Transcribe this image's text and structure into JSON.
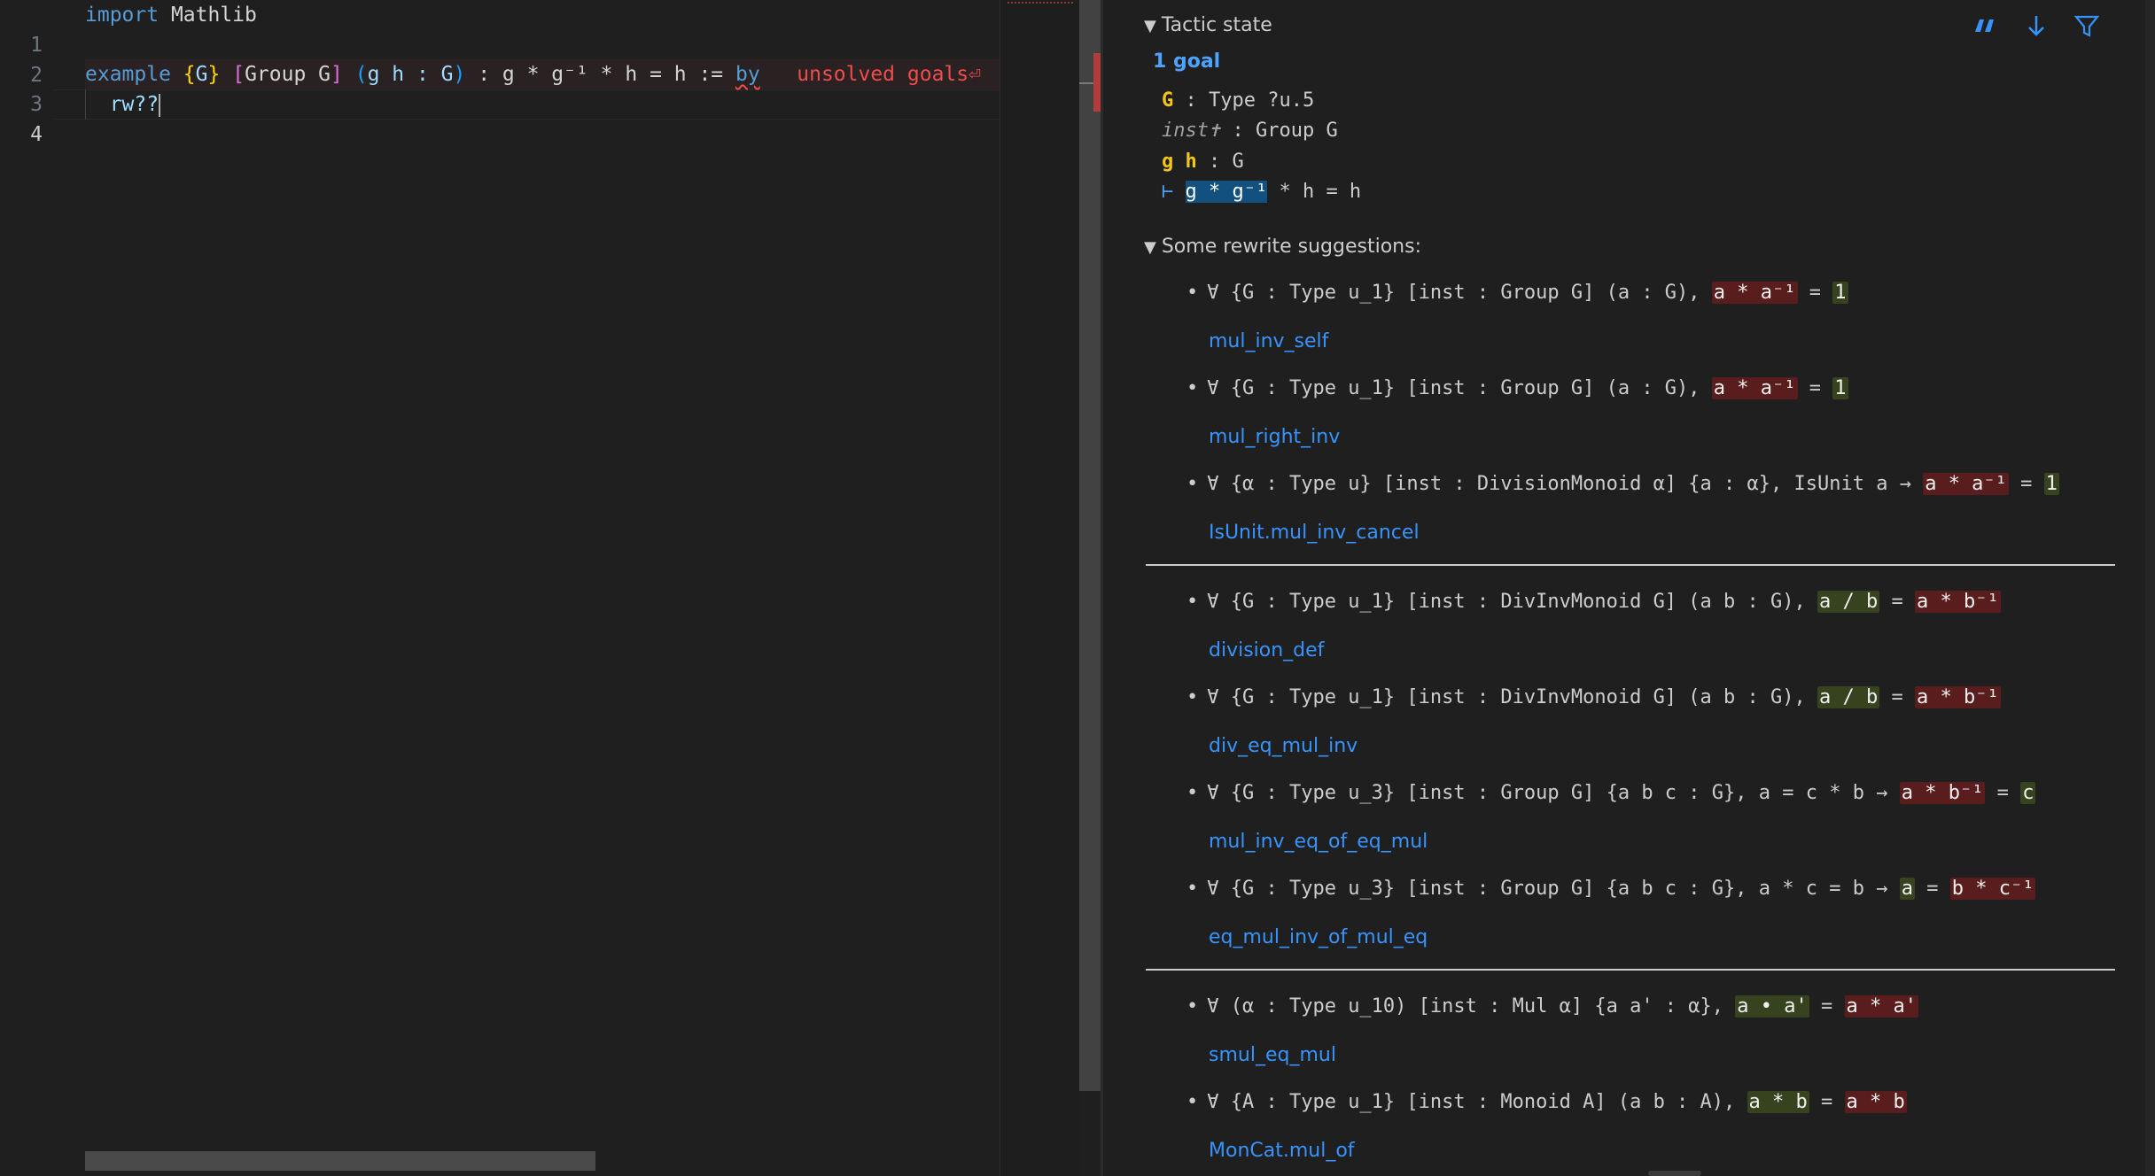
{
  "editor": {
    "lines": [
      {
        "number": "1",
        "import_kw": "import",
        "module": " Mathlib"
      },
      {
        "number": "2"
      },
      {
        "number": "3",
        "example_kw": "example",
        "b_open1": " {",
        "var_G": "G",
        "b_close1": "}",
        "b_open2": " [",
        "group_G": "Group G",
        "b_close2": "]",
        "b_open3": " (",
        "vars_gh": "g h : G",
        "b_close3": ")",
        "statement": " : g * g⁻¹ * h = h := ",
        "by_kw": "by",
        "error_text": "   unsolved goals⏎"
      },
      {
        "number": "4",
        "tactic": "  rw??"
      }
    ]
  },
  "infoview": {
    "tactic_state_label": "Tactic state",
    "goal_count": "1 goal",
    "hyps": {
      "G_name": "G",
      "G_type": " : Type ?u.5",
      "inst_name": "inst✝",
      "inst_type": " : Group G",
      "gh_name": "g h",
      "gh_type": " : G"
    },
    "goal": {
      "turnstile": "⊢ ",
      "selected": "g * g⁻¹",
      "rest": " * h = h"
    },
    "rewrite_label": "Some rewrite suggestions:",
    "icons": [
      "quote-icon",
      "arrow-down-icon",
      "filter-icon"
    ],
    "suggestions": [
      {
        "prefix": "∀ {G : Type u_1} [inst : Group G] (a : G), ",
        "lhs": "a * a⁻¹",
        "mid": " = ",
        "rhs": "1",
        "suffix": "",
        "name": "mul_inv_self"
      },
      {
        "prefix": "∀ {G : Type u_1} [inst : Group G] (a : G), ",
        "lhs": "a * a⁻¹",
        "mid": " = ",
        "rhs": "1",
        "suffix": "",
        "name": "mul_right_inv"
      },
      {
        "prefix": "∀ {α : Type u} [inst : DivisionMonoid α] {a : α}, IsUnit a → ",
        "lhs": "a * a⁻¹",
        "mid": " = ",
        "rhs": "1",
        "suffix": "",
        "name": "IsUnit.mul_inv_cancel"
      },
      {
        "prefix": "∀ {G : Type u_1} [inst : DivInvMonoid G] (a b : G), ",
        "lhs": "a / b",
        "mid": " = ",
        "rhs": "a * b⁻¹",
        "suffix": "",
        "name": "division_def"
      },
      {
        "prefix": "∀ {G : Type u_1} [inst : DivInvMonoid G] (a b : G), ",
        "lhs": "a / b",
        "mid": " = ",
        "rhs": "a * b⁻¹",
        "suffix": "",
        "name": "div_eq_mul_inv"
      },
      {
        "prefix": "∀ {G : Type u_3} [inst : Group G] {a b c : G}, a = c * b → ",
        "lhs": "a * b⁻¹",
        "mid": " = ",
        "rhs": "c",
        "suffix": "",
        "name": "mul_inv_eq_of_eq_mul"
      },
      {
        "prefix": "∀ {G : Type u_3} [inst : Group G] {a b c : G}, a * c = b → ",
        "lhs": "a",
        "mid": " = ",
        "rhs": "b * c⁻¹",
        "suffix": "",
        "name": "eq_mul_inv_of_mul_eq"
      },
      {
        "prefix": "∀ (α : Type u_10) [inst : Mul α] {a a' : α}, ",
        "lhs": "a • a'",
        "mid": " = ",
        "rhs": "a * a'",
        "suffix": "",
        "name": "smul_eq_mul"
      },
      {
        "prefix": "∀ {A : Type u_1} [inst : Monoid A] (a b : A), ",
        "lhs": "a * b",
        "mid": " = ",
        "rhs": "a * b",
        "suffix": "",
        "name": "MonCat.mul_of"
      }
    ],
    "colors": {
      "highlight_from": "#5a1d1d",
      "highlight_to": "#37421f",
      "link": "#3794ff",
      "goal_count": "#4da3ff"
    }
  }
}
